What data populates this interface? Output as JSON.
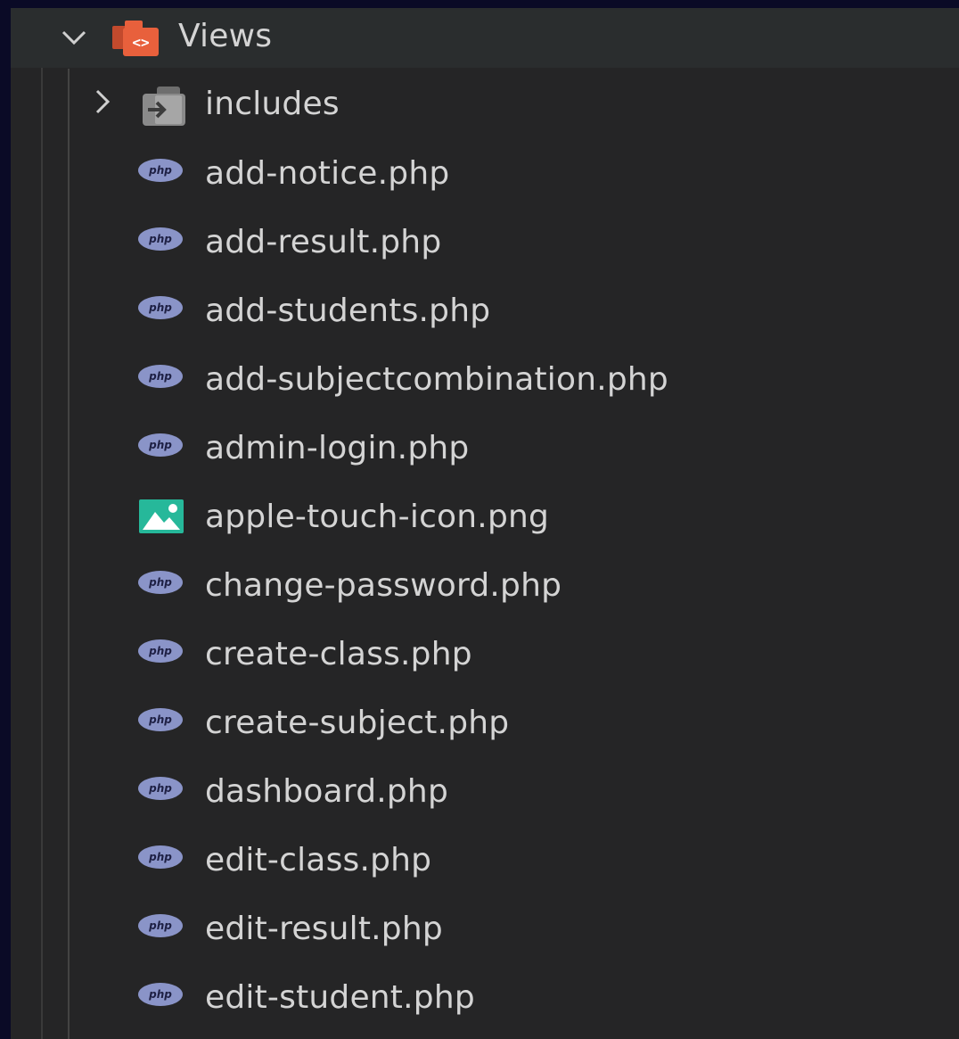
{
  "explorer": {
    "root_folder": {
      "label": "Views",
      "expanded": true,
      "icon": "views-folder-icon",
      "accent_color": "#e8603c"
    },
    "sub_folder": {
      "label": "includes",
      "expanded": false,
      "icon": "includes-folder-icon"
    },
    "files": [
      {
        "label": "add-notice.php",
        "icon": "php-file-icon"
      },
      {
        "label": "add-result.php",
        "icon": "php-file-icon"
      },
      {
        "label": "add-students.php",
        "icon": "php-file-icon"
      },
      {
        "label": "add-subjectcombination.php",
        "icon": "php-file-icon"
      },
      {
        "label": "admin-login.php",
        "icon": "php-file-icon"
      },
      {
        "label": "apple-touch-icon.png",
        "icon": "image-file-icon"
      },
      {
        "label": "change-password.php",
        "icon": "php-file-icon"
      },
      {
        "label": "create-class.php",
        "icon": "php-file-icon"
      },
      {
        "label": "create-subject.php",
        "icon": "php-file-icon"
      },
      {
        "label": "dashboard.php",
        "icon": "php-file-icon"
      },
      {
        "label": "edit-class.php",
        "icon": "php-file-icon"
      },
      {
        "label": "edit-result.php",
        "icon": "php-file-icon"
      },
      {
        "label": "edit-student.php",
        "icon": "php-file-icon"
      }
    ]
  },
  "colors": {
    "background": "#252526",
    "text": "#d4d4d4",
    "php_icon": "#8a94c8",
    "image_icon": "#26b89a"
  }
}
